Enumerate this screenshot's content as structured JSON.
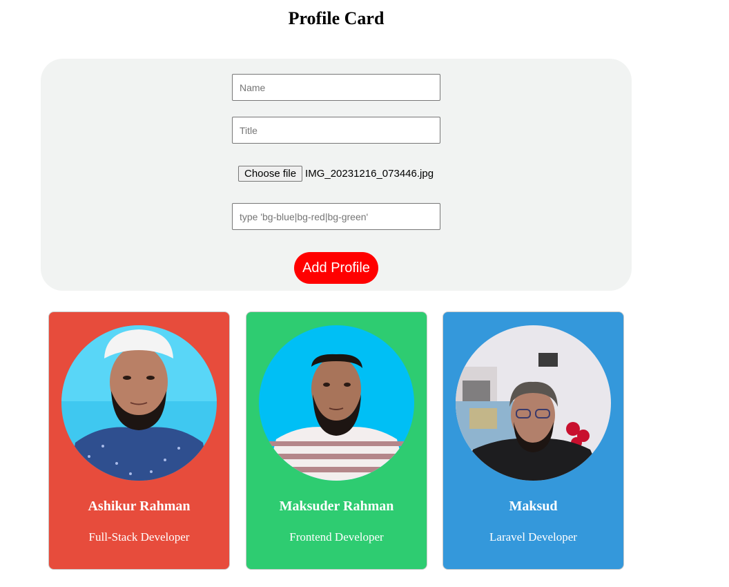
{
  "page": {
    "title": "Profile Card"
  },
  "form": {
    "name_placeholder": "Name",
    "title_placeholder": "Title",
    "file_button_label": "Choose file",
    "file_name": "IMG_20231216_073446.jpg",
    "bg_placeholder": "type 'bg-blue|bg-red|bg-green'",
    "submit_label": "Add Profile",
    "submit_color": "#ff0000"
  },
  "cards": [
    {
      "name": "Ashikur Rahman",
      "title": "Full-Stack Developer",
      "bg": "#e74c3c",
      "photo": "profile-photo"
    },
    {
      "name": "Maksuder Rahman",
      "title": "Frontend Developer",
      "bg": "#2ecc71",
      "photo": "profile-photo"
    },
    {
      "name": "Maksud",
      "title": "Laravel Developer",
      "bg": "#3498db",
      "photo": "profile-photo"
    }
  ]
}
